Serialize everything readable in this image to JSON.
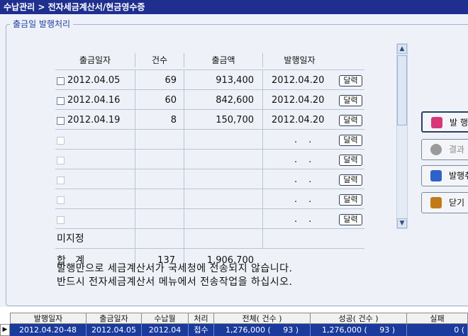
{
  "title": "수납관리 > 전자세금계산서/현금영수증",
  "group_title": "출금일 발행처리",
  "columns": [
    "출금일자",
    "건수",
    "출금액",
    "발행일자"
  ],
  "rows": [
    {
      "date": "2012.04.05",
      "count": "69",
      "amount": "913,400",
      "issue_date": "2012.04.20",
      "btn": "달력"
    },
    {
      "date": "2012.04.16",
      "count": "60",
      "amount": "842,600",
      "issue_date": "2012.04.20",
      "btn": "달력"
    },
    {
      "date": "2012.04.19",
      "count": "8",
      "amount": "150,700",
      "issue_date": "2012.04.20",
      "btn": "달력"
    },
    {
      "date": "",
      "count": "",
      "amount": "",
      "issue_date": ". .",
      "btn": "달력"
    },
    {
      "date": "",
      "count": "",
      "amount": "",
      "issue_date": ". .",
      "btn": "달력"
    },
    {
      "date": "",
      "count": "",
      "amount": "",
      "issue_date": ". .",
      "btn": "달력"
    },
    {
      "date": "",
      "count": "",
      "amount": "",
      "issue_date": ". .",
      "btn": "달력"
    },
    {
      "date": "",
      "count": "",
      "amount": "",
      "issue_date": ". .",
      "btn": "달력"
    }
  ],
  "unassigned_label": "미지정",
  "total": {
    "label": "합   계",
    "count": "137",
    "amount": "1,906,700"
  },
  "notice": [
    "발행만으로 세금계산서가 국세청에 전송되지 않습니다.",
    "반드시 전자세금계산서 메뉴에서 전송작업을 하십시오."
  ],
  "actions": [
    {
      "label": "발 행",
      "icon": "issue-icon",
      "color": "#d9367a",
      "active": true
    },
    {
      "label": "결과",
      "icon": "result-icon",
      "color": "#8a8a8a",
      "active": false
    },
    {
      "label": "발행취",
      "icon": "cancel-issue-icon",
      "color": "#2f62c8",
      "active": false
    },
    {
      "label": "닫기",
      "icon": "door-icon",
      "color": "#c27a18",
      "active": false
    }
  ],
  "bottom_table": {
    "headers": [
      "발행일자",
      "출금일자",
      "수납월",
      "처리",
      "전체( 건수 )",
      "성공( 건수 )",
      "실패"
    ],
    "row": [
      "2012.04.20-48",
      "2012.04.05",
      "2012.04",
      "접수",
      "1,276,000 (     93 )",
      "1,276,000 (     93 )",
      "0 ("
    ]
  }
}
